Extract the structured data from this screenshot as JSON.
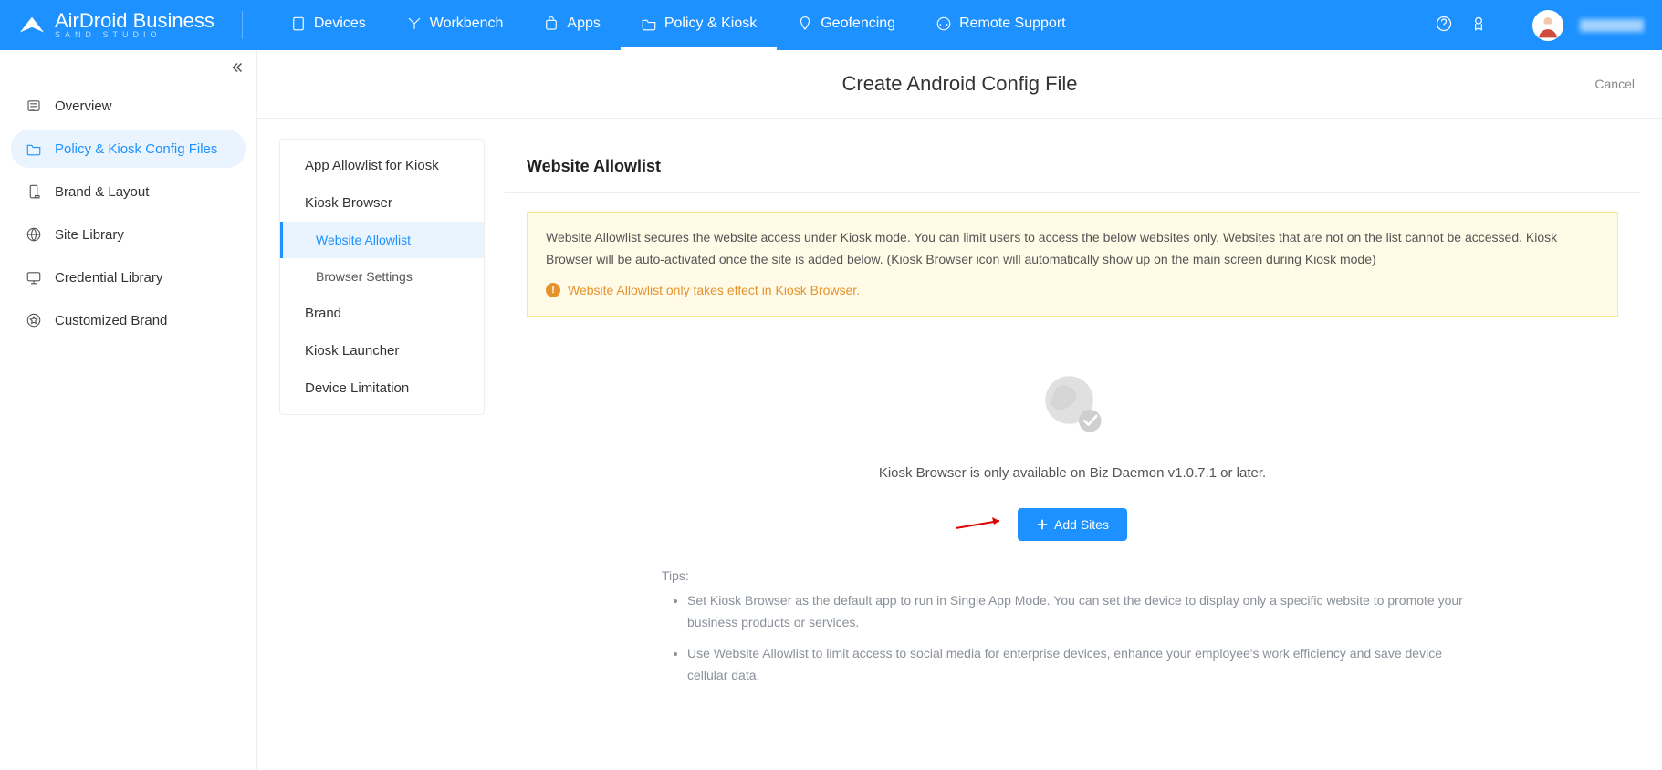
{
  "brand": {
    "name": "AirDroid Business",
    "subtitle": "Sand Studio"
  },
  "topnav": {
    "devices": "Devices",
    "workbench": "Workbench",
    "apps": "Apps",
    "policy_kiosk": "Policy & Kiosk",
    "geofencing": "Geofencing",
    "remote_support": "Remote Support"
  },
  "sidenav": {
    "overview": "Overview",
    "policy_kiosk_files": "Policy & Kiosk Config Files",
    "brand_layout": "Brand & Layout",
    "site_library": "Site Library",
    "credential_library": "Credential Library",
    "customized_brand": "Customized Brand"
  },
  "page": {
    "title": "Create Android Config File",
    "cancel": "Cancel"
  },
  "subnav": {
    "app_allowlist": "App Allowlist for Kiosk",
    "kiosk_browser": "Kiosk Browser",
    "website_allowlist": "Website Allowlist",
    "browser_settings": "Browser Settings",
    "brand": "Brand",
    "kiosk_launcher": "Kiosk Launcher",
    "device_limitation": "Device Limitation"
  },
  "panel": {
    "title": "Website Allowlist",
    "notice_text": "Website Allowlist secures the website access under Kiosk mode. You can limit users to access the below websites only. Websites that are not on the list cannot be accessed. Kiosk Browser will be auto-activated once the site is added below. (Kiosk Browser icon will automatically show up on the main screen during Kiosk mode)",
    "notice_warn": "Website Allowlist only takes effect in Kiosk Browser.",
    "empty_text": "Kiosk Browser is only available on Biz Daemon v1.0.7.1 or later.",
    "add_sites": "Add Sites",
    "tips_head": "Tips:",
    "tip1": "Set Kiosk Browser as the default app to run in Single App Mode. You can set the device to display only a specific website to promote your business products or services.",
    "tip2": "Use Website Allowlist to limit access to social media for enterprise devices, enhance your employee's work efficiency and save device cellular data."
  }
}
